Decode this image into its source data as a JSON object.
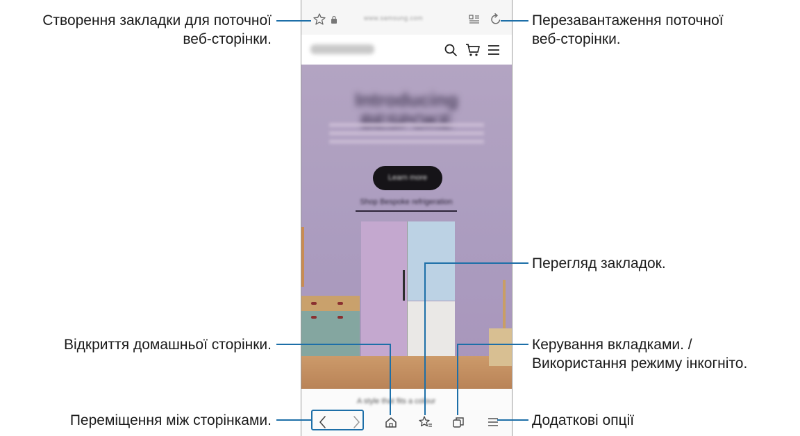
{
  "callouts": {
    "bookmark": "Створення закладки для поточної веб-сторінки.",
    "bookmark_line1": "Створення закладки для поточної",
    "bookmark_line2": "веб-сторінки.",
    "reload_line1": "Перезавантаження поточної",
    "reload_line2": "веб-сторінки.",
    "bookmarks_view": "Перегляд закладок.",
    "home": "Відкриття домашньої сторінки.",
    "tabs_line1": "Керування вкладками. /",
    "tabs_line2": "Використання режиму інкогніто.",
    "navigate": "Переміщення між сторінками.",
    "more": "Додаткові опції"
  },
  "browser": {
    "url": "www.samsung.com",
    "icons": [
      "star-icon",
      "lock-icon",
      "reader-mode-icon",
      "reload-icon",
      "search-icon",
      "cart-icon",
      "menu-icon",
      "back-icon",
      "forward-icon",
      "home-icon",
      "bookmarks-icon",
      "tabs-icon",
      "more-options-icon"
    ]
  },
  "hero": {
    "title": "Introducing BESPOKE",
    "button": "Learn more",
    "link": "Shop Bespoke refrigeration",
    "below_text": "A style that fits a colour"
  },
  "colors": {
    "accent_line": "#1d6fa8",
    "hero_bg": "#ab9cbf"
  }
}
